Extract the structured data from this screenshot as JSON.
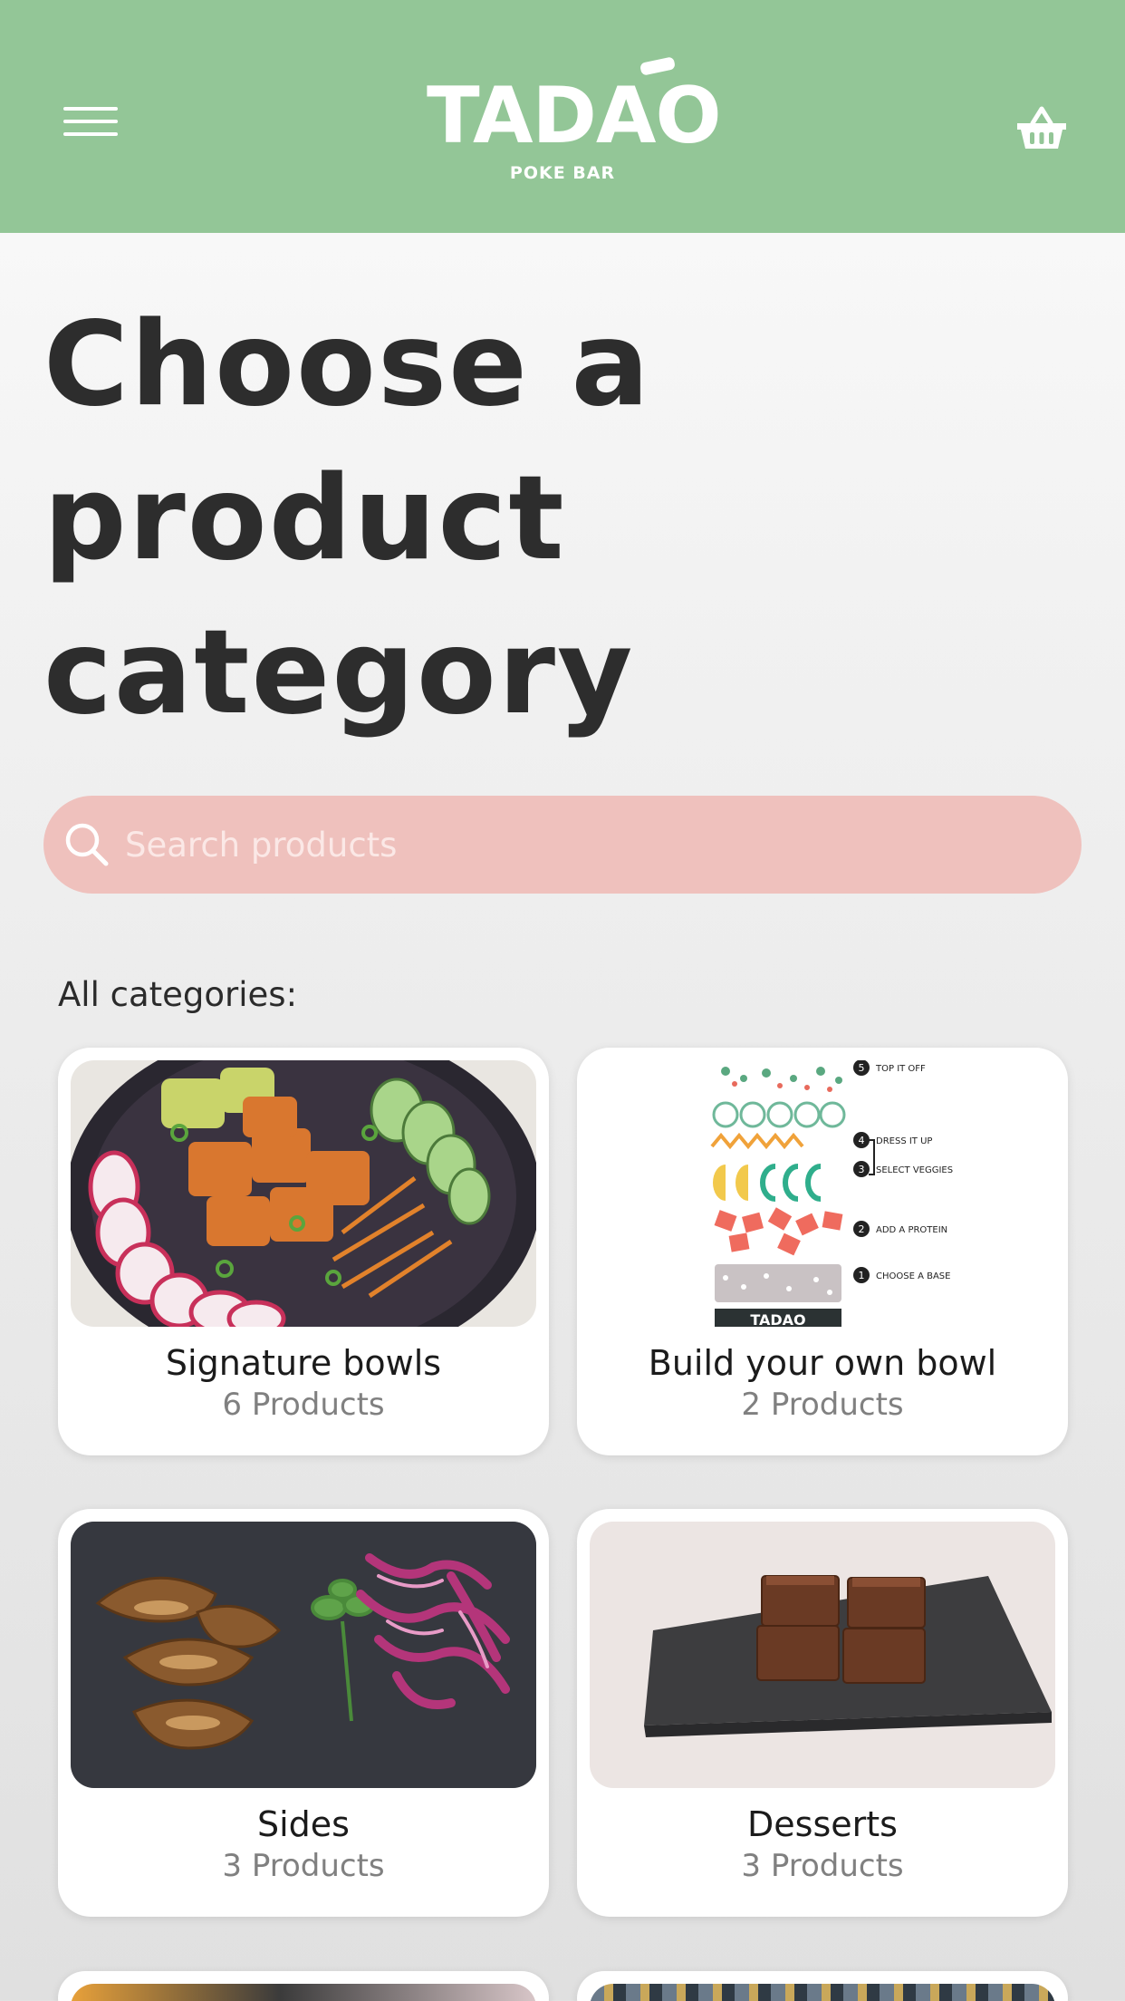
{
  "header": {
    "brand": "TADAO",
    "brand_sub": "POKE BAR",
    "menu_icon": "hamburger-icon",
    "cart_icon": "basket-icon",
    "background": "#93c697"
  },
  "main": {
    "title": "Choose a product category",
    "search": {
      "placeholder": "Search products",
      "icon": "search-icon",
      "background": "#efc1bd"
    },
    "section_label": "All categories:",
    "categories": [
      {
        "name": "Signature bowls",
        "count": "6 Products"
      },
      {
        "name": "Build your own bowl",
        "count": "2 Products",
        "steps": [
          "TOP IT OFF",
          "DRESS IT UP",
          "SELECT VEGGIES",
          "ADD A PROTEIN",
          "CHOOSE A BASE"
        ],
        "step_numbers": [
          "5",
          "4",
          "3",
          "2",
          "1"
        ],
        "bowl_logo": "TADAO"
      },
      {
        "name": "Sides",
        "count": "3 Products"
      },
      {
        "name": "Desserts",
        "count": "3 Products"
      }
    ]
  }
}
